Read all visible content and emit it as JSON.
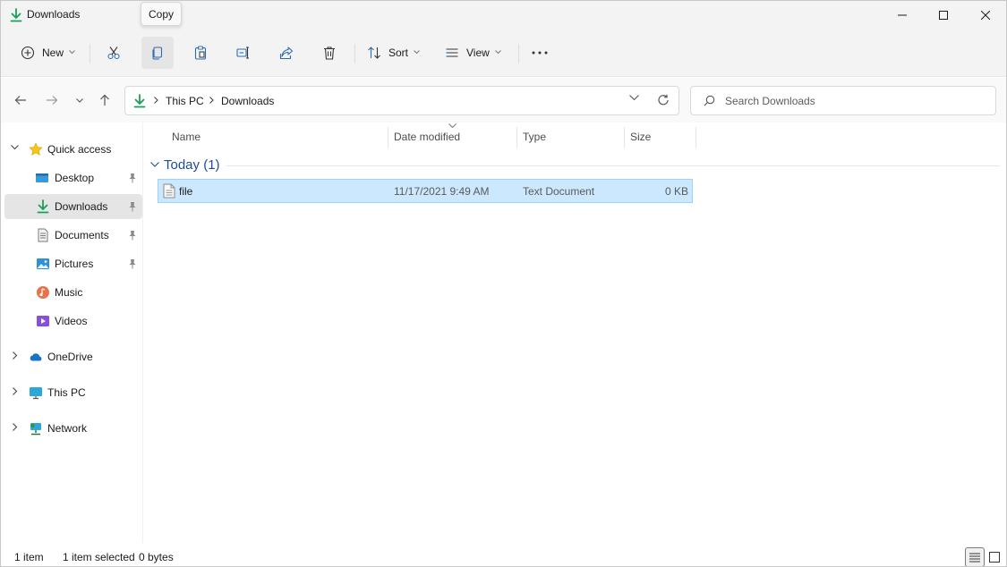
{
  "window": {
    "title": "Downloads",
    "controls": {
      "minimize": "minimize",
      "maximize": "maximize",
      "close": "close"
    }
  },
  "tooltip": {
    "text": "Copy"
  },
  "commandbar": {
    "new_label": "New",
    "sort_label": "Sort",
    "view_label": "View",
    "icons": [
      "new-icon",
      "cut-icon",
      "copy-icon",
      "paste-icon",
      "rename-icon",
      "share-icon",
      "delete-icon",
      "sort-icon",
      "view-icon",
      "more-icon"
    ]
  },
  "address": {
    "crumbs": [
      "This PC",
      "Downloads"
    ]
  },
  "search": {
    "placeholder": "Search Downloads"
  },
  "sidebar": {
    "items": [
      {
        "label": "Quick access",
        "icon": "star-icon",
        "expandable": true,
        "expanded": true
      },
      {
        "label": "Desktop",
        "icon": "desktop-icon",
        "pinned": true
      },
      {
        "label": "Downloads",
        "icon": "download-icon",
        "pinned": true,
        "selected": true
      },
      {
        "label": "Documents",
        "icon": "documents-icon",
        "pinned": true
      },
      {
        "label": "Pictures",
        "icon": "pictures-icon",
        "pinned": true
      },
      {
        "label": "Music",
        "icon": "music-icon"
      },
      {
        "label": "Videos",
        "icon": "videos-icon"
      },
      {
        "label": "OneDrive",
        "icon": "onedrive-icon",
        "expandable": true
      },
      {
        "label": "This PC",
        "icon": "this-pc-icon",
        "expandable": true
      },
      {
        "label": "Network",
        "icon": "network-icon",
        "expandable": true
      }
    ]
  },
  "columns": {
    "name": "Name",
    "date": "Date modified",
    "type": "Type",
    "size": "Size"
  },
  "groups": [
    {
      "label": "Today (1)",
      "files": [
        {
          "name": "file",
          "date": "11/17/2021 9:49 AM",
          "type": "Text Document",
          "size": "0 KB"
        }
      ]
    }
  ],
  "status": {
    "count": "1 item",
    "selection": "1 item selected",
    "selection_size": "0 bytes"
  },
  "colors": {
    "accent": "#0078d4",
    "selection": "#cce8ff",
    "group": "#1e4e8c"
  }
}
